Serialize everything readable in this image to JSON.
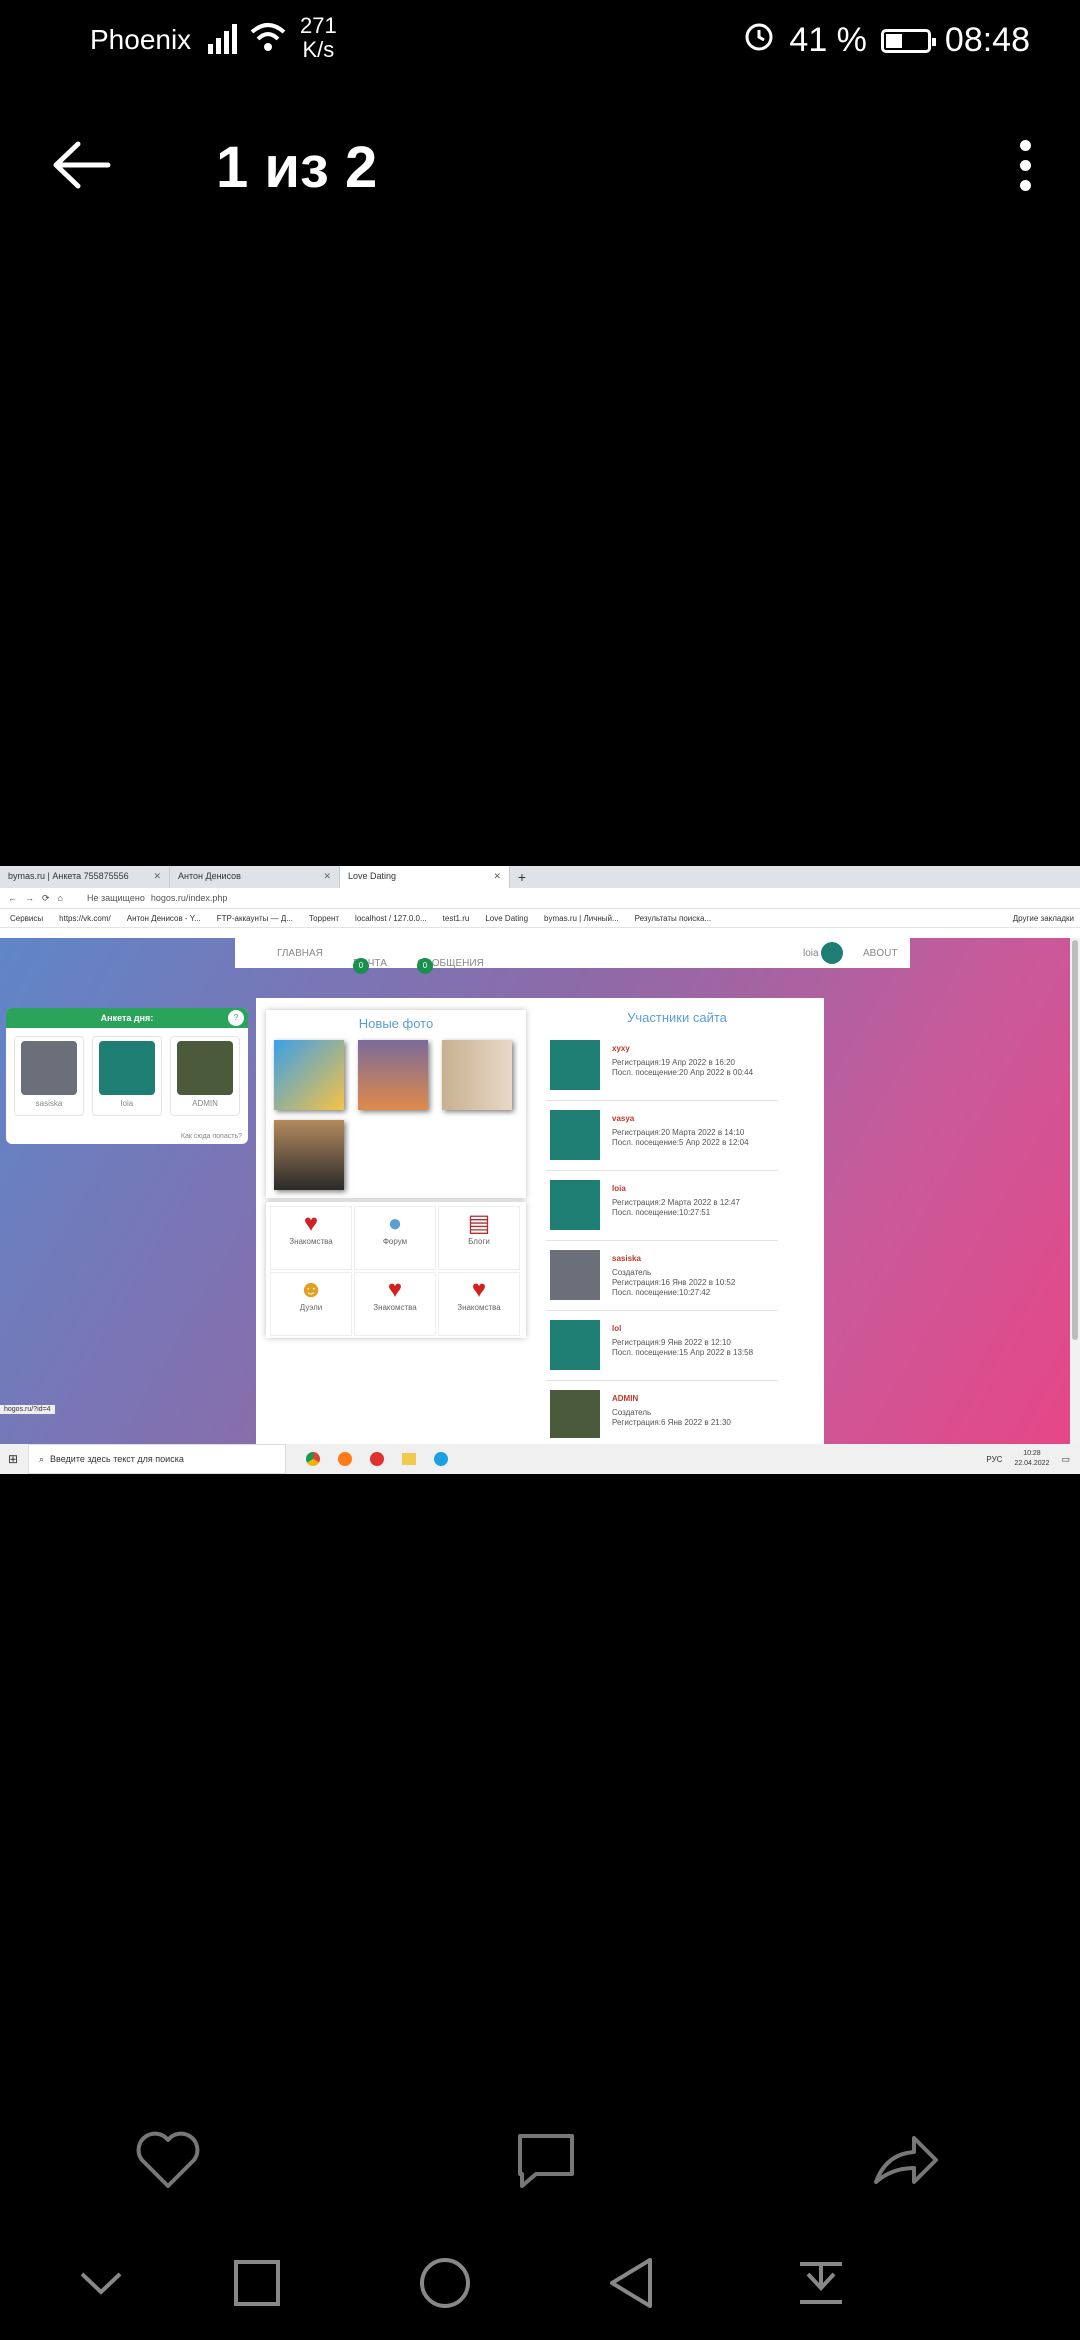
{
  "status_bar": {
    "carrier": "Phoenix",
    "speed_value": "271",
    "speed_unit": "K/s",
    "battery": "41 %",
    "battery_level": 0.41,
    "time": "08:48"
  },
  "viewer": {
    "title": "1 из 2"
  },
  "browser": {
    "tabs": [
      {
        "label": "bymas.ru | Анкета 755875556"
      },
      {
        "label": "Антон Денисов"
      },
      {
        "label": "Love Dating"
      }
    ],
    "address": {
      "security": "Не защищено",
      "url": "hogos.ru/index.php"
    },
    "bookmarks": [
      "Сервисы",
      "https://vk.com/",
      "Антон Денисов - Y...",
      "FTP-аккаунты — Д...",
      "Торрент",
      "localhost / 127.0.0...",
      "test1.ru",
      "Love Dating",
      "bymas.ru | Личный...",
      "Результаты поиска...",
      "Другие закладки"
    ]
  },
  "site": {
    "nav": {
      "home": "ГЛАВНАЯ",
      "mail": "ПОЧТА",
      "mail_count": "0",
      "messages": "СООБЩЕНИЯ",
      "messages_count": "0",
      "user": "loia",
      "about": "ABOUT"
    },
    "profile_day": {
      "title": "Анкета дня:",
      "badge": "?",
      "profiles": [
        "sasiska",
        "loia",
        "ADMIN"
      ],
      "link": "Как сюда попасть?"
    },
    "new_photos_title": "Новые фото",
    "menu": [
      "Знакомства",
      "Форум",
      "Блоги",
      "Дуэли",
      "Знакомства",
      "Знакомства"
    ],
    "members_title": "Участники сайта",
    "members": [
      {
        "name": "xyxy",
        "extra": "",
        "reg": "Регистрация:19 Апр 2022 в 16:20",
        "visit": "Посл. посещение:20 Апр 2022 в 00:44"
      },
      {
        "name": "vasya",
        "extra": "",
        "reg": "Регистрация:20 Марта 2022 в 14:10",
        "visit": "Посл. посещение:5 Апр 2022 в 12:04"
      },
      {
        "name": "loia",
        "extra": "",
        "reg": "Регистрация:2 Марта 2022 в 12:47",
        "visit": "Посл. посещение:10:27:51"
      },
      {
        "name": "sasiska",
        "extra": "Создатель",
        "reg": "Регистрация:16 Янв 2022 в 10:52",
        "visit": "Посл. посещение:10:27:42"
      },
      {
        "name": "lol",
        "extra": "",
        "reg": "Регистрация:9 Янв 2022 в 12:10",
        "visit": "Посл. посещение:15 Апр 2022 в 13:58"
      },
      {
        "name": "ADMIN",
        "extra": "Создатель",
        "reg": "Регистрация:6 Янв 2022 в 21:30",
        "visit": ""
      }
    ],
    "status_link": "hogos.ru/?id=4"
  },
  "taskbar": {
    "search_placeholder": "Введите здесь текст для поиска",
    "lang": "РУС",
    "time": "10:28",
    "date": "22.04.2022"
  },
  "colors": {
    "accent_green": "#2aa35b",
    "link_blue": "#5a9fd4",
    "gradient_start": "#5f86c8",
    "gradient_end": "#e64787"
  }
}
